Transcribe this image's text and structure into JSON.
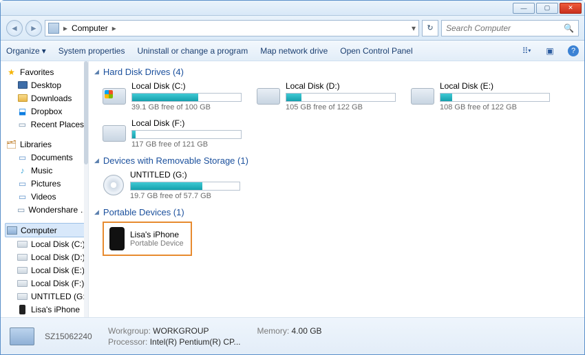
{
  "window": {
    "title": "Computer"
  },
  "addressbar": {
    "crumbs": [
      "Computer"
    ],
    "dropdown_glyph": "▾",
    "refresh_glyph": "↻"
  },
  "search": {
    "placeholder": "Search Computer"
  },
  "toolbar": {
    "organize": "Organize",
    "sysprops": "System properties",
    "uninstall": "Uninstall or change a program",
    "mapdrive": "Map network drive",
    "ctrlpanel": "Open Control Panel"
  },
  "sidebar": {
    "favorites": {
      "label": "Favorites",
      "items": [
        "Desktop",
        "Downloads",
        "Dropbox",
        "Recent Places"
      ]
    },
    "libraries": {
      "label": "Libraries",
      "items": [
        "Documents",
        "Music",
        "Pictures",
        "Videos",
        "Wondershare …"
      ]
    },
    "computer": {
      "label": "Computer",
      "items": [
        "Local Disk (C:)",
        "Local Disk (D:)",
        "Local Disk (E:)",
        "Local Disk (F:)",
        "UNTITLED (G:)",
        "Lisa's iPhone"
      ]
    }
  },
  "groups": {
    "hdd": {
      "label": "Hard Disk Drives (4)"
    },
    "removable": {
      "label": "Devices with Removable Storage (1)"
    },
    "portable": {
      "label": "Portable Devices (1)"
    }
  },
  "drives": {
    "c": {
      "name": "Local Disk (C:)",
      "free": "39.1 GB free of 100 GB",
      "pct": 61
    },
    "d": {
      "name": "Local Disk (D:)",
      "free": "105 GB free of 122 GB",
      "pct": 14
    },
    "e": {
      "name": "Local Disk (E:)",
      "free": "108 GB free of 122 GB",
      "pct": 11
    },
    "f": {
      "name": "Local Disk (F:)",
      "free": "117 GB free of 121 GB",
      "pct": 3
    },
    "g": {
      "name": "UNTITLED (G:)",
      "free": "19.7 GB free of 57.7 GB",
      "pct": 66
    }
  },
  "portable": {
    "name": "Lisa's iPhone",
    "sub": "Portable Device"
  },
  "status": {
    "name": "SZ15062240",
    "workgroup_label": "Workgroup:",
    "workgroup": "WORKGROUP",
    "memory_label": "Memory:",
    "memory": "4.00 GB",
    "processor_label": "Processor:",
    "processor": "Intel(R) Pentium(R) CP..."
  }
}
